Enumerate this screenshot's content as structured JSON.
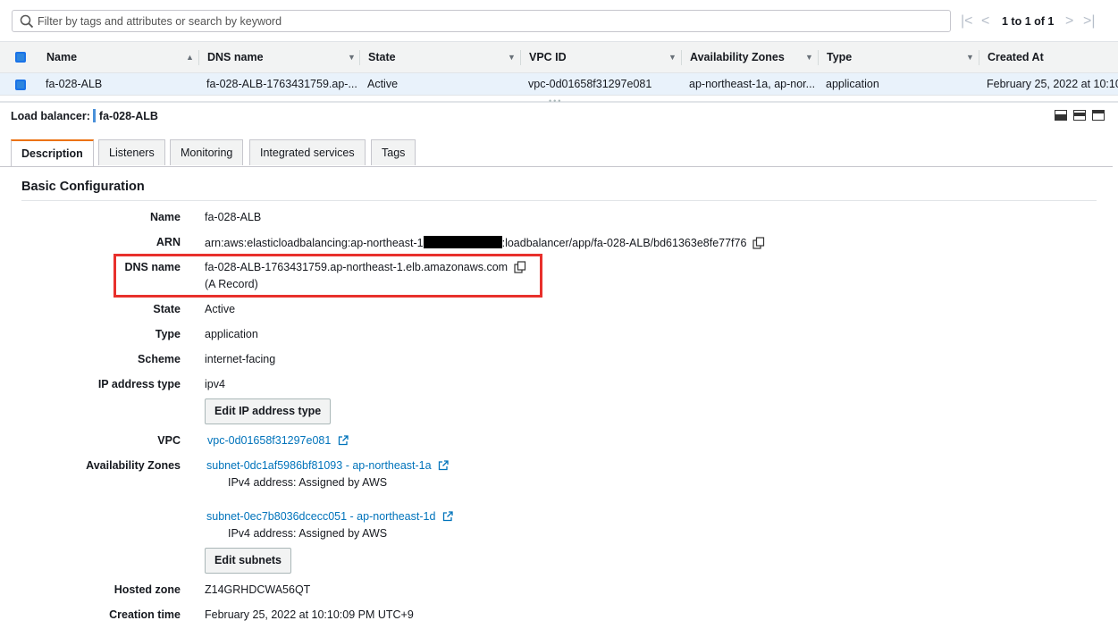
{
  "filter": {
    "placeholder": "Filter by tags and attributes or search by keyword",
    "pagination_text": "1 to 1 of 1"
  },
  "table": {
    "columns": [
      "Name",
      "DNS name",
      "State",
      "VPC ID",
      "Availability Zones",
      "Type",
      "Created At"
    ],
    "row": {
      "name": "fa-028-ALB",
      "dns_name": "fa-028-ALB-1763431759.ap-...",
      "state": "Active",
      "vpc_id": "vpc-0d01658f31297e081",
      "availability_zones": "ap-northeast-1a, ap-nor...",
      "type": "application",
      "created_at": "February 25, 2022 at 10:10"
    }
  },
  "details_header": {
    "label": "Load balancer:",
    "name": "fa-028-ALB"
  },
  "tabs": [
    "Description",
    "Listeners",
    "Monitoring",
    "Integrated services",
    "Tags"
  ],
  "basic_config": {
    "title": "Basic Configuration",
    "labels": {
      "name": "Name",
      "arn": "ARN",
      "dns": "DNS name",
      "state": "State",
      "type": "Type",
      "scheme": "Scheme",
      "ip_type": "IP address type",
      "vpc": "VPC",
      "azs": "Availability Zones",
      "hosted_zone": "Hosted zone",
      "creation_time": "Creation time"
    },
    "name": "fa-028-ALB",
    "arn_prefix": "arn:aws:elasticloadbalancing:ap-northeast-1",
    "arn_suffix": ":loadbalancer/app/fa-028-ALB/bd61363e8fe77f76",
    "dns_name": "fa-028-ALB-1763431759.ap-northeast-1.elb.amazonaws.com",
    "dns_record": "(A Record)",
    "state": "Active",
    "type": "application",
    "scheme": "internet-facing",
    "ip_address_type": "ipv4",
    "edit_ip_button": "Edit IP address type",
    "vpc": "vpc-0d01658f31297e081",
    "subnets": [
      {
        "link": "subnet-0dc1af5986bf81093 - ap-northeast-1a",
        "ipv4": "IPv4 address: Assigned by AWS"
      },
      {
        "link": "subnet-0ec7b8036dcecc051 - ap-northeast-1d",
        "ipv4": "IPv4 address: Assigned by AWS"
      }
    ],
    "edit_subnets_button": "Edit subnets",
    "hosted_zone": "Z14GRHDCWA56QT",
    "creation_time": "February 25, 2022 at 10:10:09 PM UTC+9"
  },
  "colors": {
    "link": "#0073bb",
    "highlight": "#e8302c",
    "active_tab_accent": "#ec7211",
    "selected_row": "#e9f2fb"
  }
}
